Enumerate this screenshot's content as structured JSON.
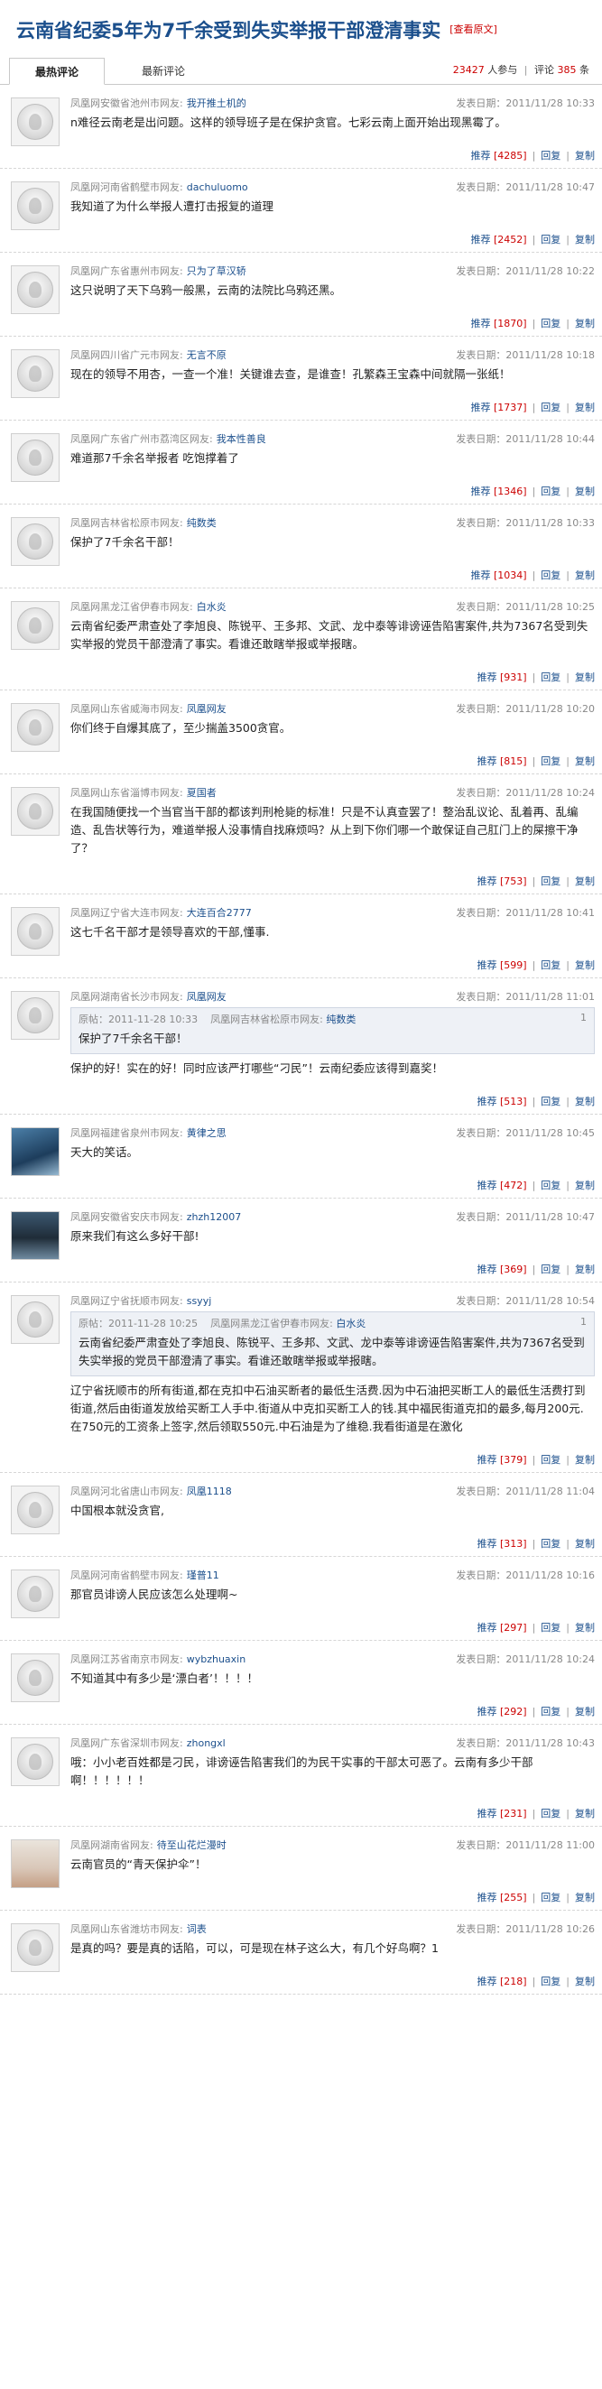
{
  "page": {
    "title": "云南省纪委5年为7千余受到失实举报干部澄清事实",
    "original_link": "[查看原文]"
  },
  "tabs": [
    {
      "label": "最热评论",
      "active": true
    },
    {
      "label": "最新评论",
      "active": false
    }
  ],
  "stats": {
    "participants": "23427",
    "participants_label": "人参与",
    "comments_label": "评论",
    "comments": "385",
    "comments_suffix": "条"
  },
  "action_labels": {
    "recommend": "推荐",
    "reply": "回复",
    "copy": "复制"
  },
  "colors": {
    "title": "#1b4f8c",
    "link": "#1b4f8c",
    "count": "#cc0000",
    "quote_bg": "#eef1f6"
  },
  "comments": [
    {
      "avatar": "default-avatar-icon",
      "location": "凤凰网安徽省池州市网友:",
      "nick": "我开推土机的",
      "date": "发表日期：2011/11/28 10:33",
      "text": "n难径云南老是出问题。这样的领导班子是在保护贪官。七彩云南上面开始出现黑霉了。",
      "count": "[4285]"
    },
    {
      "avatar": "default-avatar-icon",
      "location": "凤凰网河南省鹤壁市网友:",
      "nick": "dachuluomo",
      "date": "发表日期：2011/11/28 10:47",
      "text": "我知道了为什么举报人遭打击报复的道理",
      "count": "[2452]"
    },
    {
      "avatar": "default-avatar-icon",
      "location": "凤凰网广东省惠州市网友:",
      "nick": "只为了草汉轿",
      "date": "发表日期：2011/11/28 10:22",
      "text": "这只说明了天下乌鸦一般黑，云南的法院比乌鸦还黑。",
      "count": "[1870]"
    },
    {
      "avatar": "default-avatar-icon",
      "location": "凤凰网四川省广元市网友:",
      "nick": "无言不原",
      "date": "发表日期：2011/11/28 10:18",
      "text": "现在的领导不用杏，一查一个准！关键谁去查，是谁查！孔繁森王宝森中间就隔一张纸！",
      "count": "[1737]"
    },
    {
      "avatar": "default-avatar-icon",
      "location": "凤凰网广东省广州市荔湾区网友:",
      "nick": "我本性善良",
      "date": "发表日期：2011/11/28 10:44",
      "text": "难道那7千余名举报者 吃饱撑着了",
      "count": "[1346]"
    },
    {
      "avatar": "default-avatar-icon",
      "location": "凤凰网吉林省松原市网友:",
      "nick": "纯数类",
      "date": "发表日期：2011/11/28 10:33",
      "text": "保护了7千余名干部！",
      "count": "[1034]"
    },
    {
      "avatar": "default-avatar-icon",
      "location": "凤凰网黑龙江省伊春市网友:",
      "nick": "白水炎",
      "date": "发表日期：2011/11/28 10:25",
      "text": "云南省纪委严肃查处了李旭良、陈锐平、王多邦、文武、龙中泰等诽谤诬告陷害案件,共为7367名受到失实举报的党员干部澄清了事实。看谁还敢瞎举报或举报瞎。",
      "count": "[931]"
    },
    {
      "avatar": "default-avatar-icon",
      "location": "凤凰网山东省威海市网友:",
      "nick": "凤凰网友",
      "date": "发表日期：2011/11/28 10:20",
      "text": "你们终于自爆其底了，至少揣盖3500贪官。",
      "count": "[815]"
    },
    {
      "avatar": "default-avatar-icon",
      "location": "凤凰网山东省淄博市网友:",
      "nick": "夏国者",
      "date": "发表日期：2011/11/28 10:24",
      "text": "在我国随便找一个当官当干部的都该判刑枪毙的标准！只是不认真查罢了！整治乱议论、乱着再、乱编造、乱告状等行为，难道举报人没事情自找麻烦吗？从上到下你们哪一个敢保证自己肛门上的屎擦干净了？",
      "count": "[753]"
    },
    {
      "avatar": "default-avatar-icon",
      "location": "凤凰网辽宁省大连市网友:",
      "nick": "大连百合2777",
      "date": "发表日期：2011/11/28 10:41",
      "text": "这七千名干部才是领导喜欢的干部,懂事.",
      "count": "[599]"
    },
    {
      "avatar": "default-avatar-icon",
      "location": "凤凰网湖南省长沙市网友:",
      "nick": "凤凰网友",
      "date": "发表日期：2011/11/28 11:01",
      "quote": {
        "date": "原帖：2011-11-28 10:33",
        "location": "凤凰网吉林省松原市网友:",
        "nick": "纯数类",
        "floor": "1",
        "text": "保护了7千余名干部！"
      },
      "text": "保护的好！实在的好！同时应该严打哪些“刁民”！云南纪委应该得到嘉奖！",
      "count": "[513]"
    },
    {
      "avatar": "photo-avatar-icon",
      "location": "凤凰网福建省泉州市网友:",
      "nick": "黄律之思",
      "date": "发表日期：2011/11/28 10:45",
      "text": "天大的笑话。",
      "count": "[472]"
    },
    {
      "avatar": "photo-avatar-icon",
      "location": "凤凰网安徽省安庆市网友:",
      "nick": "zhzh12007",
      "date": "发表日期：2011/11/28 10:47",
      "text": "原来我们有这么多好干部!",
      "count": "[369]"
    },
    {
      "avatar": "default-avatar-icon",
      "location": "凤凰网辽宁省抚顺市网友:",
      "nick": "ssyyj",
      "date": "发表日期：2011/11/28 10:54",
      "quote": {
        "date": "原帖：2011-11-28 10:25",
        "location": "凤凰网黑龙江省伊春市网友:",
        "nick": "白水炎",
        "floor": "1",
        "text": "云南省纪委严肃查处了李旭良、陈锐平、王多邦、文武、龙中泰等诽谤诬告陷害案件,共为7367名受到失实举报的党员干部澄清了事实。看谁还敢瞎举报或举报瞎。"
      },
      "text": "辽宁省抚顺市的所有街道,都在克扣中石油买断者的最低生活费.因为中石油把买断工人的最低生活费打到街道,然后由街道发放给买断工人手中.街道从中克扣买断工人的钱.其中福民街道克扣的最多,每月200元.在750元的工资条上签字,然后领取550元.中石油是为了维稳.我看街道是在激化",
      "count": "[379]"
    },
    {
      "avatar": "default-avatar-icon",
      "location": "凤凰网河北省唐山市网友:",
      "nick": "凤凰1118",
      "date": "发表日期：2011/11/28 11:04",
      "text": "中国根本就没贪官,",
      "count": "[313]"
    },
    {
      "avatar": "default-avatar-icon",
      "location": "凤凰网河南省鹤壁市网友:",
      "nick": "瑾普11",
      "date": "发表日期：2011/11/28 10:16",
      "text": "那官员诽谤人民应该怎么处理啊~",
      "count": "[297]"
    },
    {
      "avatar": "default-avatar-icon",
      "location": "凤凰网江苏省南京市网友:",
      "nick": "wybzhuaxin",
      "date": "发表日期：2011/11/28 10:24",
      "text": "不知道其中有多少是‘漂白者’！！！！",
      "count": "[292]"
    },
    {
      "avatar": "default-avatar-icon",
      "location": "凤凰网广东省深圳市网友:",
      "nick": "zhongxl",
      "date": "发表日期：2011/11/28 10:43",
      "text": "哦：小小老百姓都是刁民，诽谤诬告陷害我们的为民干实事的干部太可恶了。云南有多少干部啊！！！！！！",
      "count": "[231]"
    },
    {
      "avatar": "photo-avatar-icon",
      "location": "凤凰网湖南省网友:",
      "nick": "待至山花烂漫时",
      "date": "发表日期：2011/11/28 11:00",
      "text": "云南官员的“青天保护伞”！",
      "count": "[255]"
    },
    {
      "avatar": "default-avatar-icon",
      "location": "凤凰网山东省潍坊市网友:",
      "nick": "词表",
      "date": "发表日期：2011/11/28 10:26",
      "text": "是真的吗？要是真的话陷，可以，可是现在林子这么大，有几个好鸟啊？1",
      "count": "[218]"
    }
  ]
}
